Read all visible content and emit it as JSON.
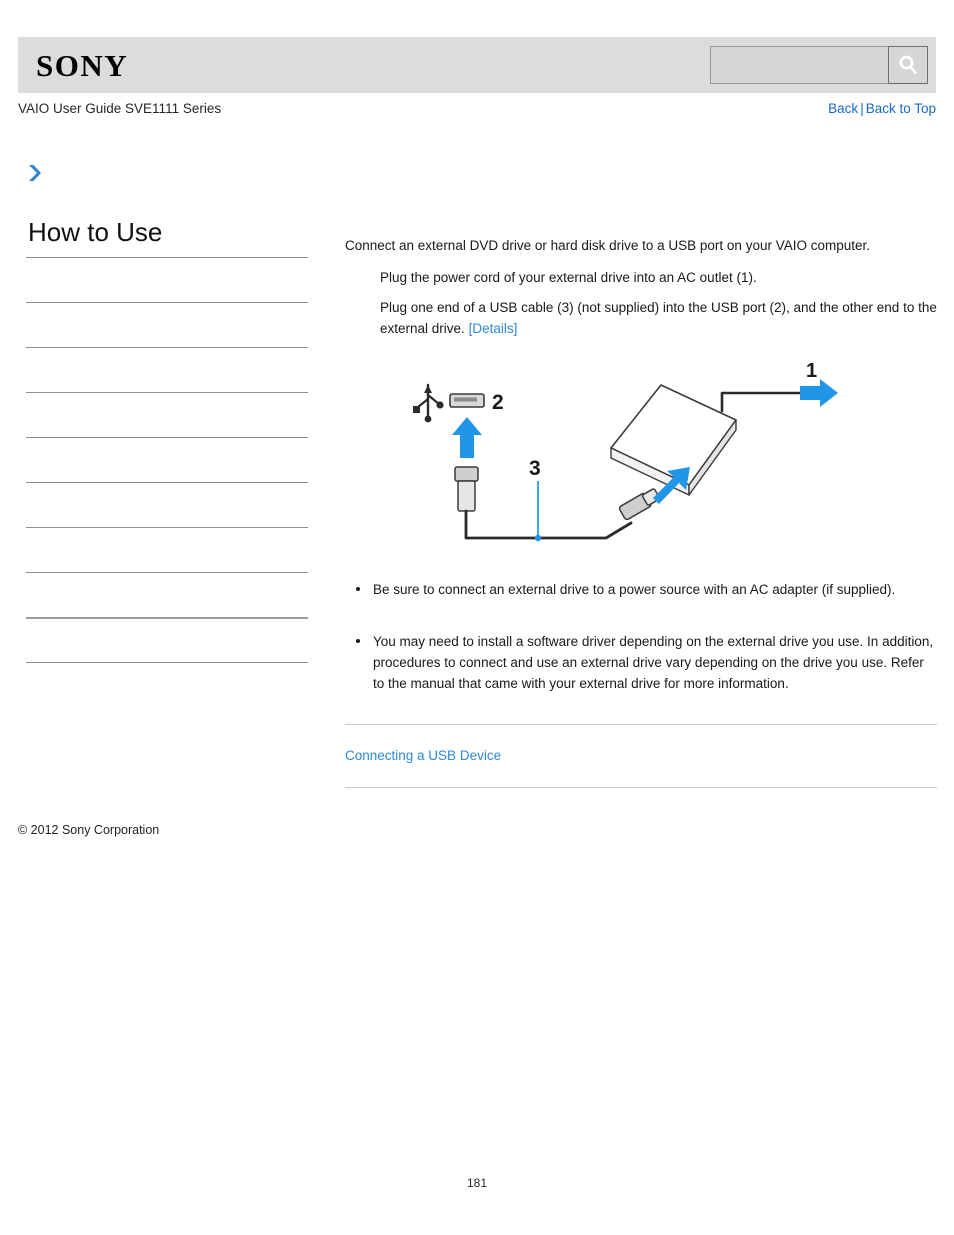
{
  "header": {
    "logo_text": "SONY",
    "search": {
      "value": "",
      "placeholder": "",
      "button_icon": "search-icon"
    }
  },
  "breadcrumb": {
    "guide_title": "VAIO User Guide SVE1111 Series",
    "back_label": "Back",
    "separator": "|",
    "back_to_top_label": "Back to Top"
  },
  "marker": {
    "icon": "chevron-right-icon",
    "color": "#2e87c8"
  },
  "sidebar": {
    "title": "How to Use",
    "items": [
      {
        "label": ""
      },
      {
        "label": ""
      },
      {
        "label": ""
      },
      {
        "label": ""
      },
      {
        "label": ""
      },
      {
        "label": ""
      },
      {
        "label": ""
      },
      {
        "label": ""
      },
      {
        "label": ""
      },
      {
        "label": ""
      }
    ]
  },
  "main": {
    "intro": "Connect an external DVD drive or hard disk drive to a USB port on your VAIO computer.",
    "steps": [
      {
        "text": "Plug the power cord of your external drive into an AC outlet (1)."
      },
      {
        "text": "Plug one end of a USB cable (3) (not supplied) into the USB port (2), and the other end to the external drive.",
        "link_label": "[Details]"
      }
    ],
    "figure": {
      "alt": "External drive connected to VAIO USB port diagram",
      "callouts": [
        "1",
        "2",
        "3"
      ],
      "accent_color": "#2196e8"
    },
    "notes": [
      "Be sure to connect an external drive to a power source with an AC adapter (if supplied).",
      "You may need to install a software driver depending on the external drive you use. In addition, procedures to connect and use an external drive vary depending on the drive you use. Refer to the manual that came with your external drive for more information."
    ],
    "related_link": "Connecting a USB Device"
  },
  "footer": {
    "copyright": "© 2012 Sony Corporation",
    "page_number": "181"
  }
}
